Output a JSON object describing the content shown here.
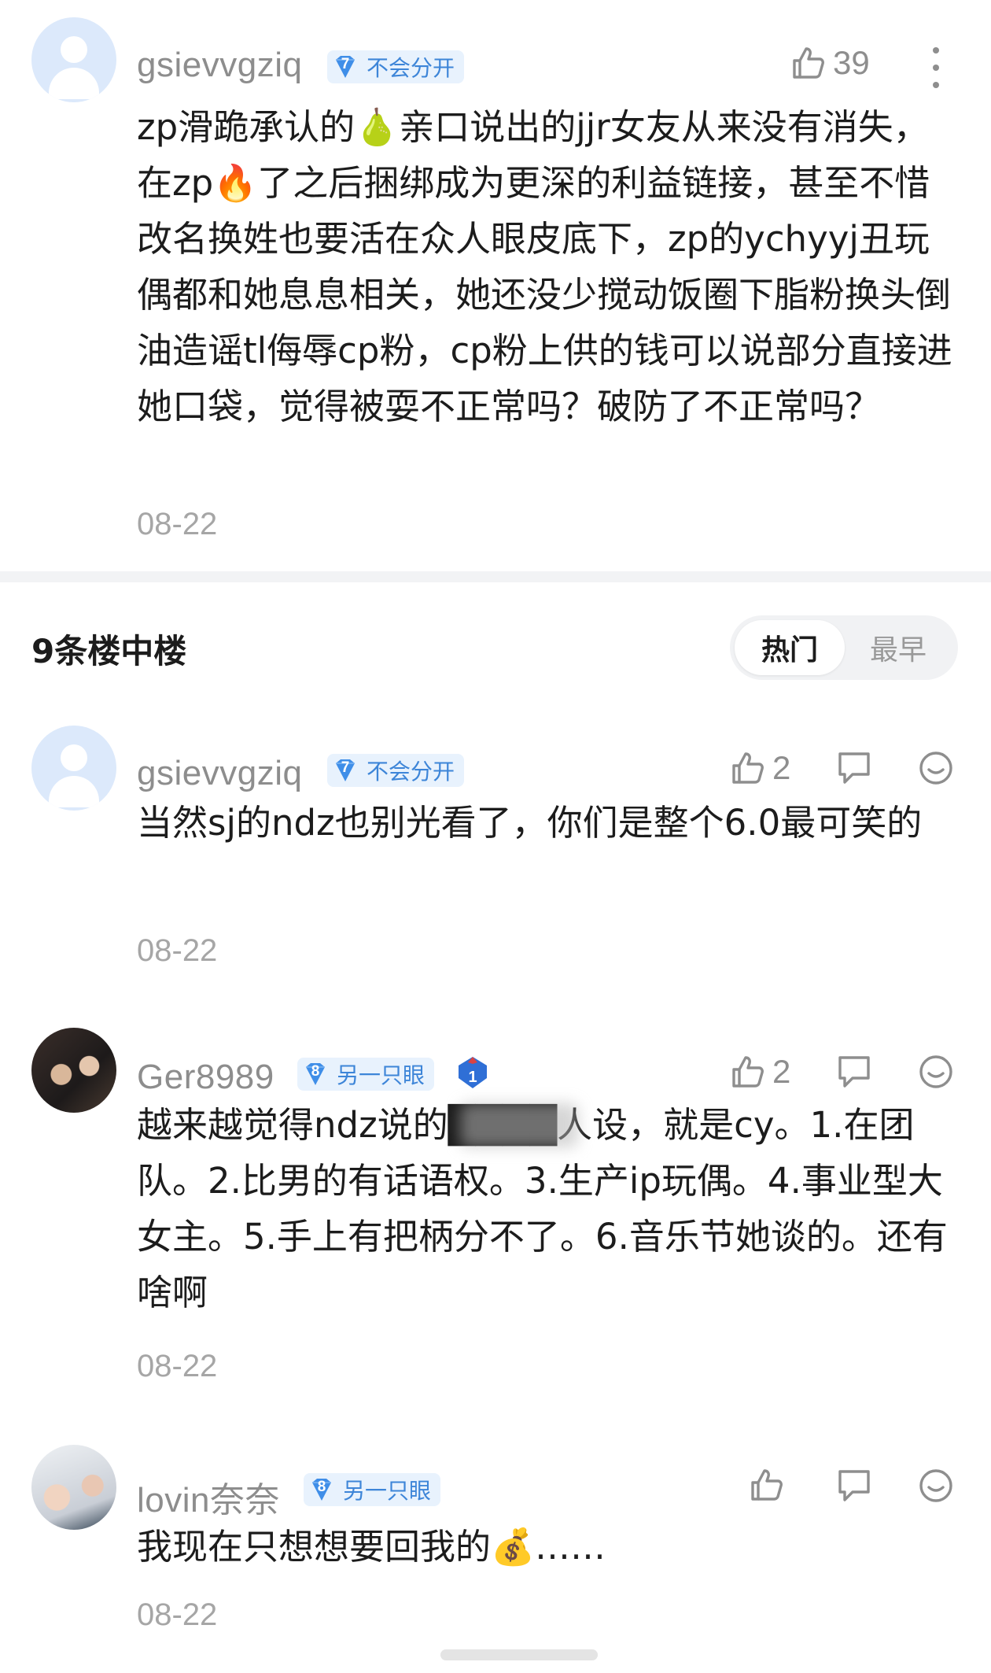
{
  "top_comment": {
    "username": "gsievvgziq",
    "badge_level": "7",
    "badge_label": "不会分开",
    "like_count": "39",
    "text": "zp滑跪承认的🍐亲口说出的jjr女友从来没有消失，在zp🔥了之后捆绑成为更深的利益链接，甚至不惜改名换姓也要活在众人眼皮底下，zp的ychyyj丑玩偶都和她息息相关，她还没少搅动饭圈下脂粉换头倒油造谣tl侮辱cp粉，cp粉上供的钱可以说部分直接进她口袋，觉得被耍不正常吗？破防了不正常吗？",
    "date": "08-22"
  },
  "replies_header": {
    "title": "9条楼中楼",
    "sort_options": [
      "热门",
      "最早"
    ],
    "active_sort": "热门"
  },
  "replies": [
    {
      "username": "gsievvgziq",
      "badge_level": "7",
      "badge_label": "不会分开",
      "like_count": "2",
      "text": "当然sj的ndz也别光看了，你们是整个6.0最可笑的",
      "date": "08-22",
      "avatar": "default-avatar"
    },
    {
      "username": "Ger8989",
      "badge_level": "8",
      "badge_label": "另一只眼",
      "rank_badge": "1",
      "like_count": "2",
      "text": "越来越觉得ndz说的████人设，就是cy。1.在团队。2.比男的有话语权。3.生产ip玩偶。4.事业型大女主。5.手上有把柄分不了。6.音乐节她谈的。还有啥啊",
      "date": "08-22",
      "avatar": "photo-avatar"
    },
    {
      "username": "lovin奈奈",
      "badge_level": "8",
      "badge_label": "另一只眼",
      "like_count": "",
      "text": "我现在只想想要回我的💰……",
      "date": "08-22",
      "avatar": "photo-avatar"
    }
  ],
  "colors": {
    "badge_bg": "#e8f2fd",
    "badge_text": "#3d85d8",
    "gray_text": "#8d8d8d",
    "divider": "#f2f3f5"
  },
  "icons": [
    "thumbs-up-icon",
    "more-vertical-icon",
    "reply-bubble-icon",
    "smile-face-icon",
    "diamond-level-icon",
    "rank-shield-icon"
  ]
}
